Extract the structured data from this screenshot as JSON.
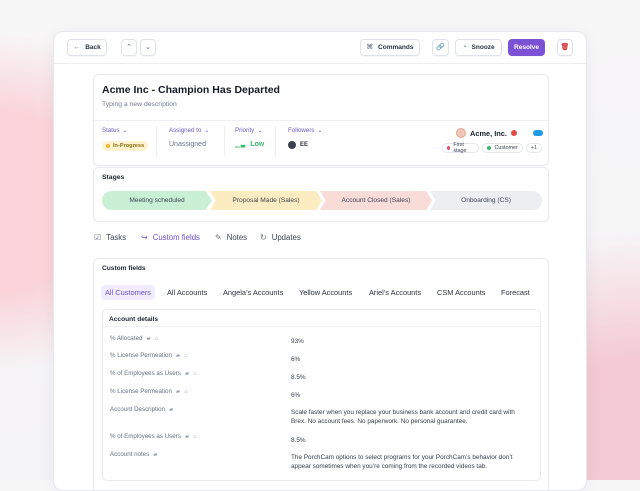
{
  "topbar": {
    "back_label": "Back",
    "commands_label": "Commands",
    "snooze_label": "Snooze",
    "resolve_label": "Resolve",
    "icons": {
      "back": "←",
      "up": "⌃",
      "down": "⌄",
      "commands": "⌘",
      "link": "🔗",
      "snooze": "◔",
      "delete": "🗑"
    }
  },
  "ticket": {
    "title": "Acme Inc - Champion Has Departed",
    "description": "Typing a new description",
    "status_label": "Status",
    "status_value": "In-Progress",
    "assigned_label": "Assigned to",
    "assigned_value": "Unassigned",
    "priority_label": "Priority",
    "priority_value": "Low",
    "followers_label": "Followers",
    "followers_value": "EE",
    "customer_name": "Acme, Inc.",
    "tags": [
      "First stage",
      "Customer",
      "+1"
    ],
    "colors": {
      "accent": "#7b52d6",
      "status_yellow": "#f0b72f",
      "stage_green": "#3cb86b",
      "danger": "#e04b45",
      "brand_blue": "#1e9be8"
    }
  },
  "stages": {
    "label": "Stages",
    "items": [
      "Meeting scheduled",
      "Proposal Made (Sales)",
      "Account Closed (Sales)",
      "Onboarding (CS)"
    ]
  },
  "tabs": [
    {
      "label": "Tasks",
      "icon": "☑"
    },
    {
      "label": "Custom fields",
      "icon": "↪"
    },
    {
      "label": "Notes",
      "icon": "✎"
    },
    {
      "label": "Updates",
      "icon": "↻"
    }
  ],
  "custom_fields": {
    "label": "Custom fields",
    "subtabs": [
      "All Customers",
      "All Accounts",
      "Angela’s Accounts",
      "Yellow Accounts",
      "Ariel’s Accounts",
      "CSM Accounts",
      "Forecast"
    ],
    "details_title": "Account details",
    "rows": [
      {
        "label": "% Allocated",
        "value": "93%"
      },
      {
        "label": "% License Permeation",
        "value": "6%"
      },
      {
        "label": "% of Employees as Users",
        "value": "8.5%"
      },
      {
        "label": "% License Permeation",
        "value": "6%"
      },
      {
        "label": "Account Description",
        "value_lines": [
          "Scale faster when you replace your business bank account and credit card with",
          "Brex. No account fees. No paperwork. No personal guarantee."
        ]
      },
      {
        "label": "% of Employees as Users",
        "value": "8.5%"
      },
      {
        "label": "Account notes",
        "value_lines": [
          "The PorchCam options to select programs for your PorchCam’s behavior don’t",
          "appear sometimes when you’re coming from the recorded videos tab."
        ]
      }
    ]
  }
}
